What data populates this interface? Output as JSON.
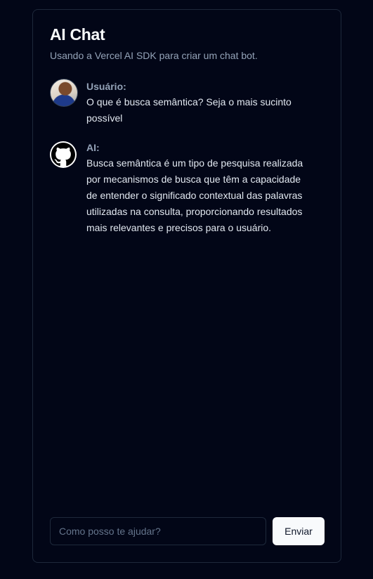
{
  "header": {
    "title": "AI Chat",
    "subtitle": "Usando a Vercel AI SDK para criar um chat bot."
  },
  "messages": [
    {
      "sender": "Usuário:",
      "avatar_icon": "user-photo-avatar",
      "text": "O que é busca semântica? Seja o mais sucinto possível"
    },
    {
      "sender": "AI:",
      "avatar_icon": "github-icon",
      "text": "Busca semântica é um tipo de pesquisa realizada por mecanismos de busca que têm a capacidade de entender o significado contextual das palavras utilizadas na consulta, proporcionando resultados mais relevantes e precisos para o usuário."
    }
  ],
  "composer": {
    "placeholder": "Como posso te ajudar?",
    "value": "",
    "send_label": "Enviar"
  },
  "colors": {
    "background": "#020617",
    "border": "#1e293b",
    "title": "#f8fafc",
    "muted": "#94a3b8",
    "text": "#e2e8f0",
    "button_bg": "#f8fafc",
    "button_text": "#0f172a"
  }
}
